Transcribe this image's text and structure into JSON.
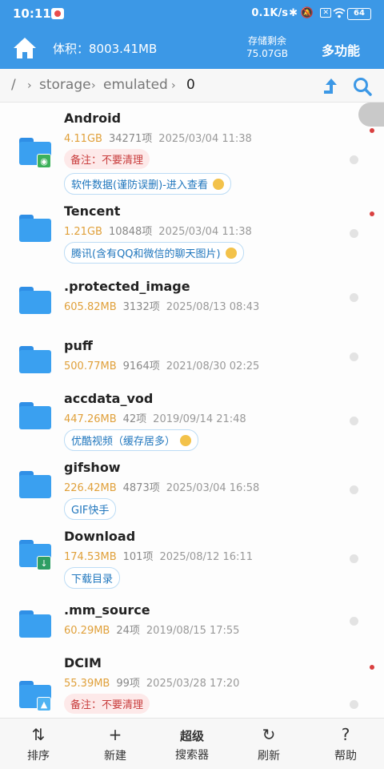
{
  "status_bar": {
    "time": "10:11",
    "net_speed": "0.1K/s",
    "battery": "64",
    "icons": [
      "app-notification-icon",
      "bluetooth-icon",
      "mute-icon",
      "sim-icon",
      "wifi-icon",
      "battery-icon"
    ]
  },
  "header": {
    "volume": "体积：8003.41MB",
    "remain_label": "存储剩余",
    "remain_value": "75.07GB",
    "more_label": "多功能",
    "accent": "#3c98e6"
  },
  "breadcrumb": {
    "root": "/",
    "items": [
      "storage",
      "emulated"
    ],
    "current": "0"
  },
  "files": [
    {
      "name": "Android",
      "size": "4.11GB",
      "count": "34271项",
      "date": "2025/03/04 11:38",
      "badge": "android-icon",
      "badge_color": "#3cb15a",
      "tags": [
        {
          "text": "备注：不要清理",
          "style": "red"
        },
        {
          "text": "软件数据(谨防误删)-进入查看",
          "style": "blue",
          "bulb": true
        }
      ]
    },
    {
      "name": "Tencent",
      "size": "1.21GB",
      "count": "10848项",
      "date": "2025/03/04 11:38",
      "tags": [
        {
          "text": "腾讯(含有QQ和微信的聊天图片)",
          "style": "blue",
          "bulb": true
        }
      ]
    },
    {
      "name": ".protected_image",
      "size": "605.82MB",
      "count": "3132项",
      "date": "2025/08/13 08:43",
      "tags": []
    },
    {
      "name": "puff",
      "size": "500.77MB",
      "count": "9164项",
      "date": "2021/08/30 02:25",
      "tags": []
    },
    {
      "name": "accdata_vod",
      "size": "447.26MB",
      "count": "42项",
      "date": "2019/09/14 21:48",
      "tags": [
        {
          "text": "优酷视频（缓存居多）",
          "style": "blue",
          "bulb": true
        }
      ]
    },
    {
      "name": "gifshow",
      "size": "226.42MB",
      "count": "4873项",
      "date": "2025/03/04 16:58",
      "tags": [
        {
          "text": "GIF快手",
          "style": "blue"
        }
      ]
    },
    {
      "name": "Download",
      "size": "174.53MB",
      "count": "101项",
      "date": "2025/08/12 16:11",
      "badge": "download-arrow-icon",
      "badge_color": "#2f9e64",
      "tags": [
        {
          "text": "下载目录",
          "style": "blue"
        }
      ]
    },
    {
      "name": ".mm_source",
      "size": "60.29MB",
      "count": "24项",
      "date": "2019/08/15 17:55",
      "tags": []
    },
    {
      "name": "DCIM",
      "size": "55.39MB",
      "count": "99项",
      "date": "2025/03/28 17:20",
      "badge": "image-icon",
      "badge_color": "#4fb3f2",
      "tags": [
        {
          "text": "备注：不要清理",
          "style": "red"
        }
      ]
    }
  ],
  "bottom_nav": [
    {
      "icon": "sort-icon",
      "glyph": "⇅",
      "label": "排序"
    },
    {
      "icon": "add-icon",
      "glyph": "+",
      "label": "新建"
    },
    {
      "icon": "super-search-icon",
      "glyph": "超级",
      "label": "搜索器"
    },
    {
      "icon": "refresh-icon",
      "glyph": "↻",
      "label": "刷新"
    },
    {
      "icon": "help-icon",
      "glyph": "?",
      "label": "帮助"
    }
  ]
}
